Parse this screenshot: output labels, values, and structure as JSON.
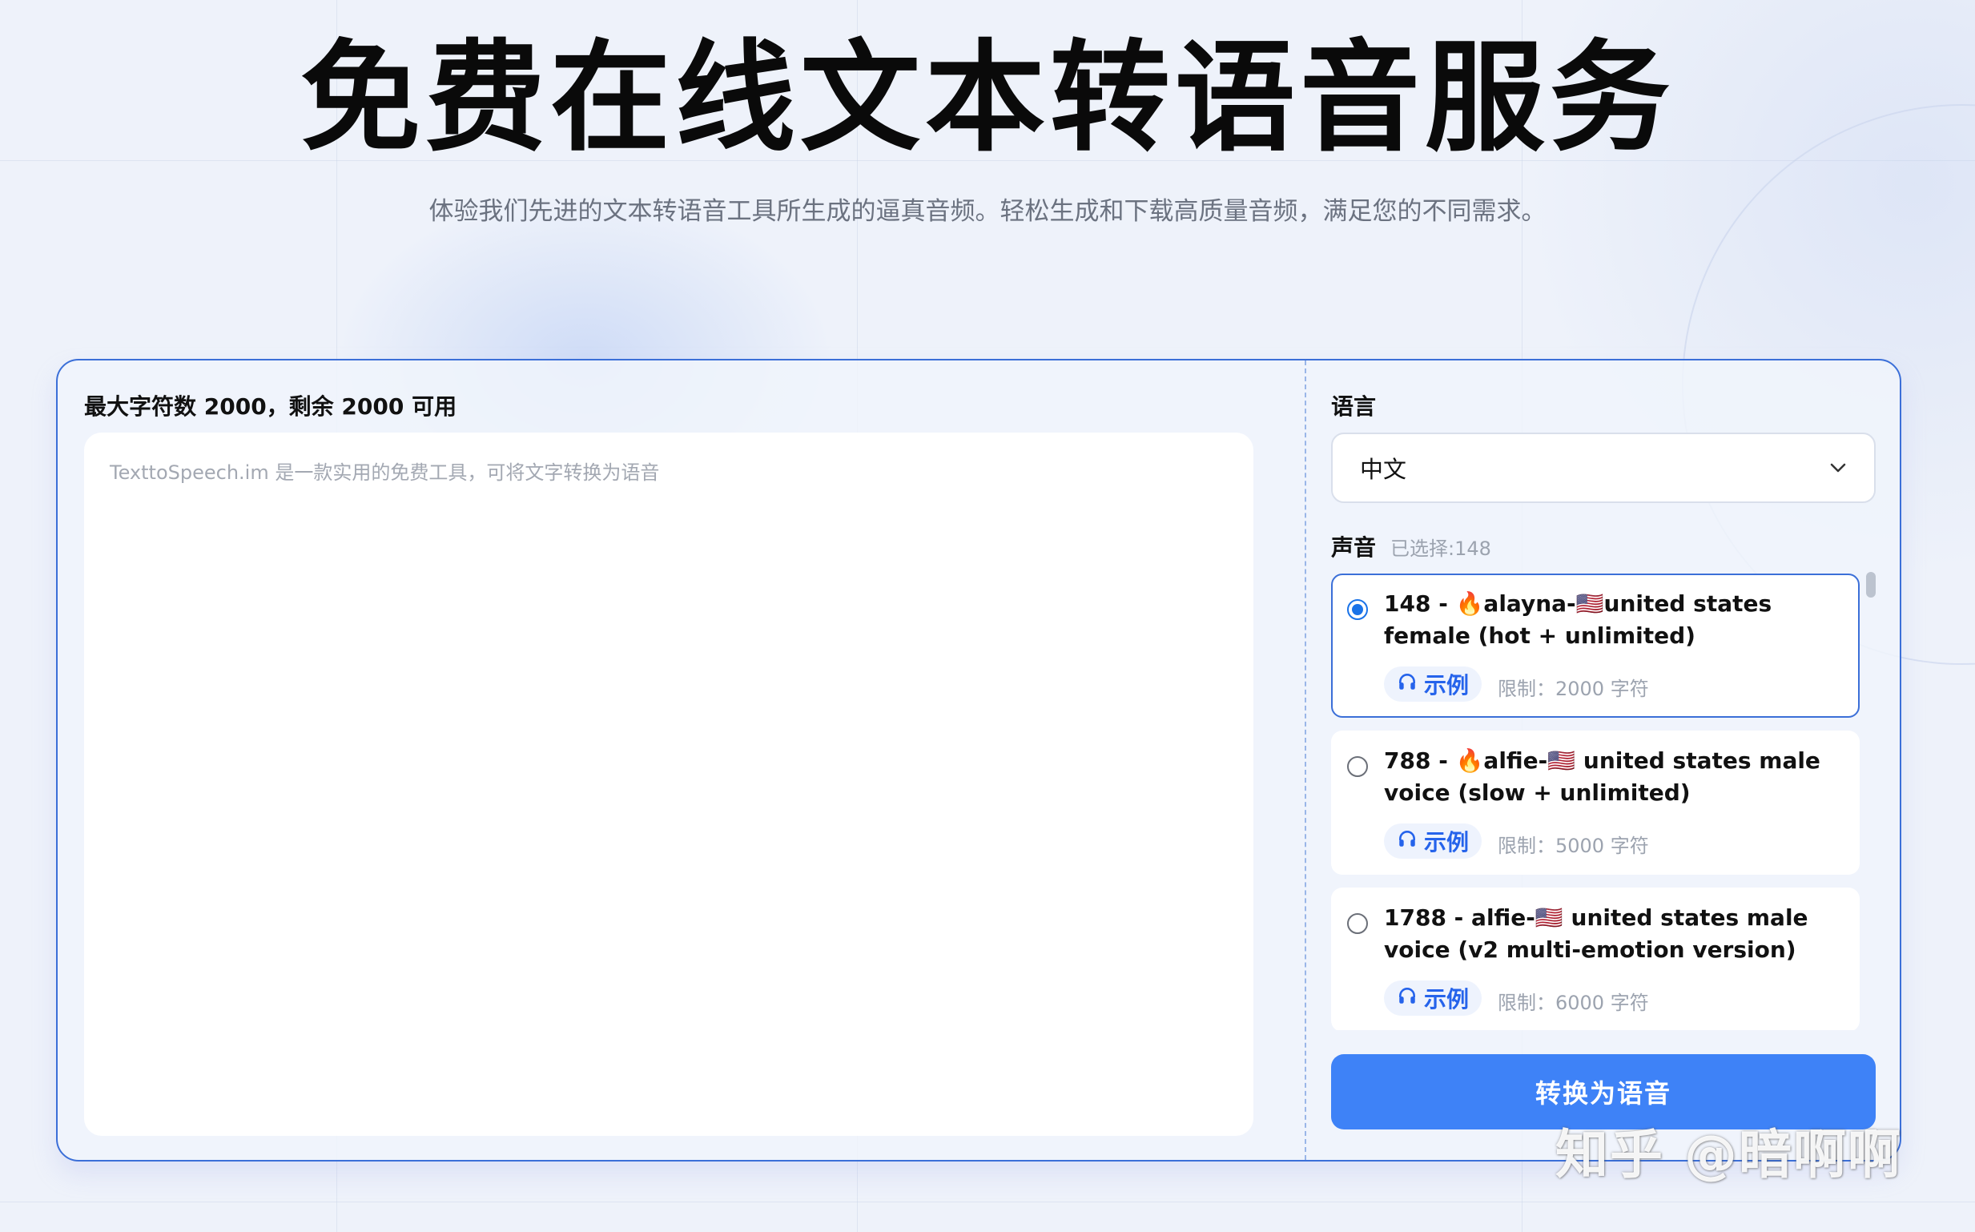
{
  "hero": {
    "title": "免费在线文本转语音服务",
    "subtitle": "体验我们先进的文本转语音工具所生成的逼真音频。轻松生成和下载高质量音频，满足您的不同需求。"
  },
  "editor": {
    "char_count_label": "最大字符数 2000，剩余 2000 可用",
    "placeholder": "TexttoSpeech.im 是一款实用的免费工具，可将文字转换为语音"
  },
  "language": {
    "label": "语言",
    "selected": "中文"
  },
  "voice": {
    "label": "声音",
    "selected_text": "已选择:148",
    "items": [
      {
        "name": "148 - 🔥alayna-🇺🇸united states female (hot + unlimited)",
        "sample_label": "示例",
        "limit": "限制：2000 字符",
        "selected": true
      },
      {
        "name": "788 - 🔥alfie-🇺🇸 united states male voice (slow + unlimited)",
        "sample_label": "示例",
        "limit": "限制：5000 字符",
        "selected": false
      },
      {
        "name": "1788 - alfie-🇺🇸 united states male voice (v2 multi-emotion version)",
        "sample_label": "示例",
        "limit": "限制：6000 字符",
        "selected": false
      }
    ]
  },
  "convert_button": "转换为语音",
  "watermark": "知乎 @暗啊啊",
  "colors": {
    "accent": "#3e82f7",
    "border": "#3b6fd8",
    "background": "#eef2fa"
  }
}
